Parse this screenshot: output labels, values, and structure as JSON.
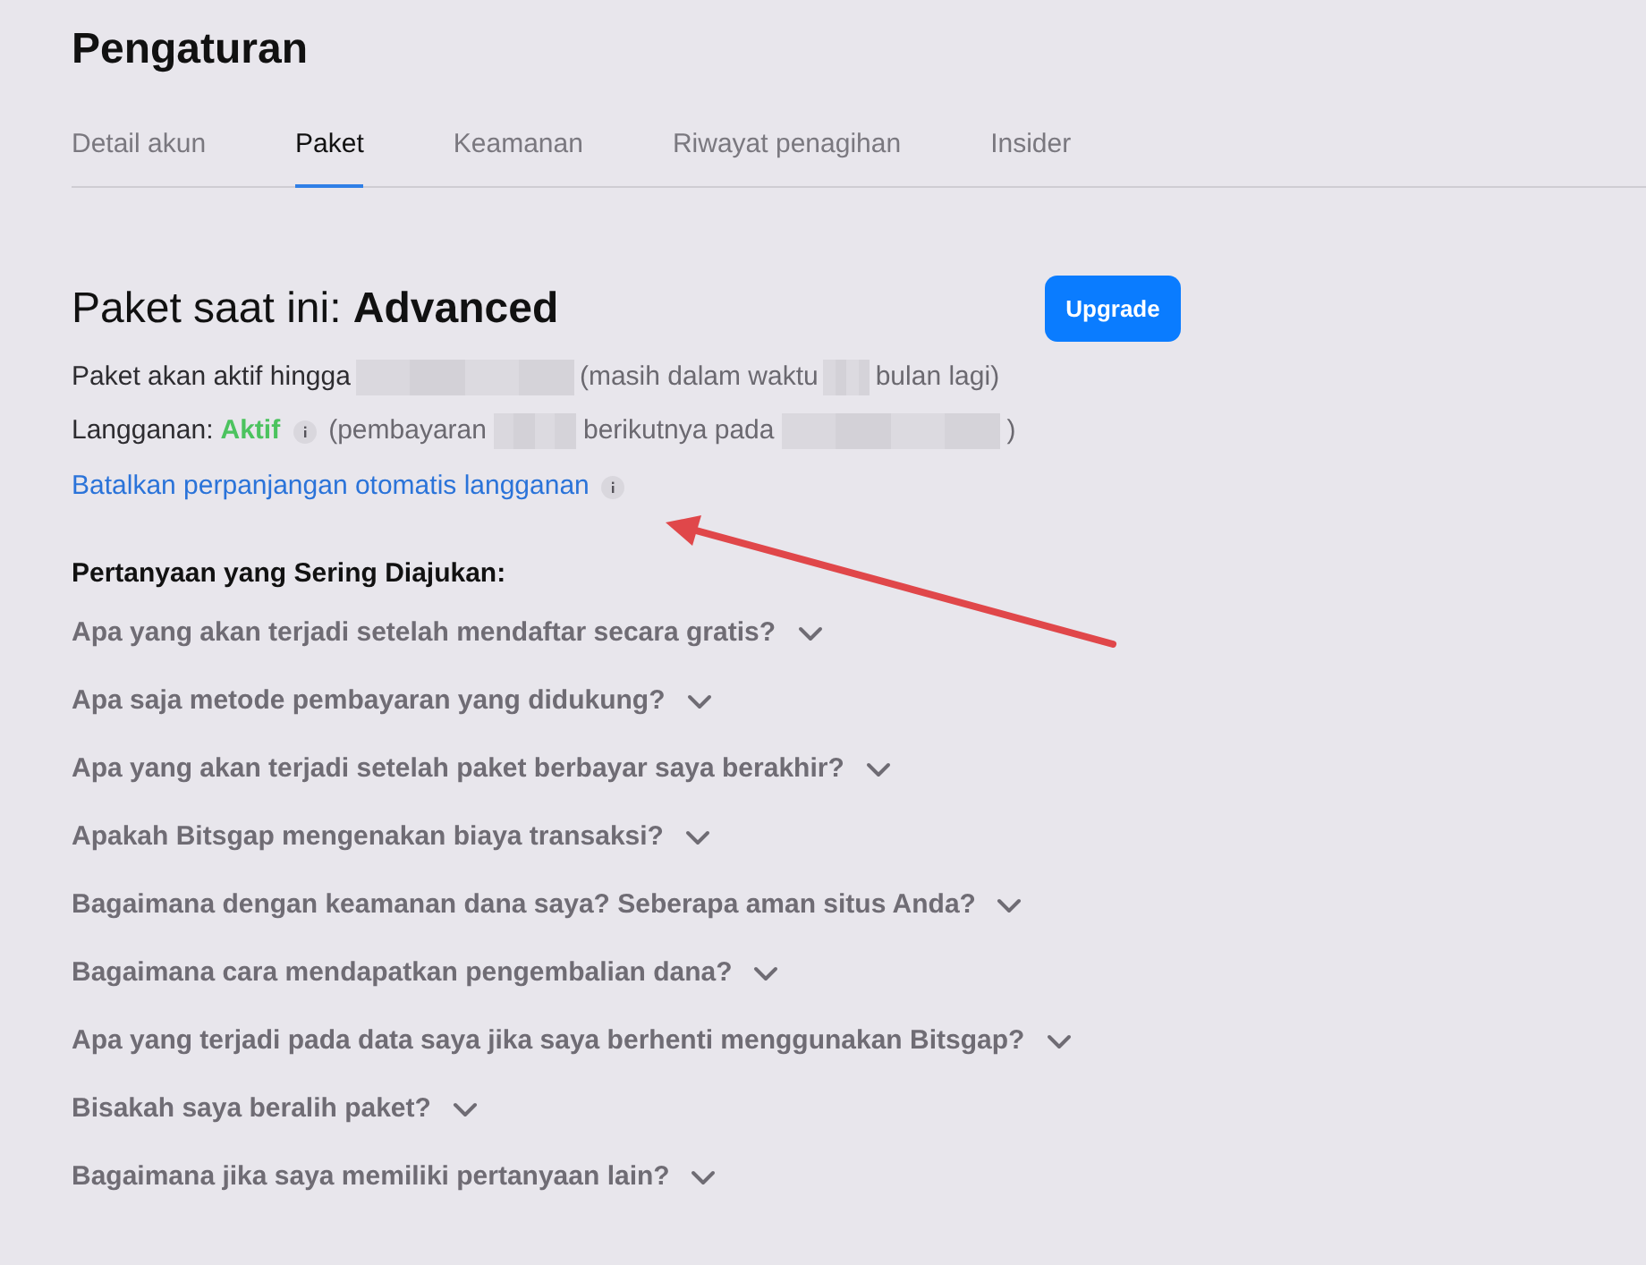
{
  "page": {
    "title": "Pengaturan"
  },
  "tabs": [
    {
      "label": "Detail akun",
      "selected": false
    },
    {
      "label": "Paket",
      "selected": true
    },
    {
      "label": "Keamanan",
      "selected": false
    },
    {
      "label": "Riwayat penagihan",
      "selected": false
    },
    {
      "label": "Insider",
      "selected": false
    }
  ],
  "plan": {
    "heading": "Paket saat ini: **Advanced**",
    "upgrade_button": "Upgrade",
    "active_until": [
      {
        "kind": "text",
        "text": "Paket akan aktif hingga"
      },
      {
        "kind": "redacted"
      },
      {
        "kind": "note",
        "text": "(masih dalam waktu"
      },
      {
        "kind": "redacted"
      },
      {
        "kind": "note",
        "text": "bulan lagi)"
      }
    ],
    "subscription": {
      "label": "Langganan:",
      "status": "Aktif",
      "segments": [
        {
          "kind": "note",
          "text": "(pembayaran"
        },
        {
          "kind": "redacted"
        },
        {
          "kind": "note",
          "text": "berikutnya pada"
        },
        {
          "kind": "redacted"
        },
        {
          "kind": "note",
          "text": ")"
        }
      ]
    },
    "cancel_link": "Batalkan perpanjangan otomatis langganan"
  },
  "faq": {
    "heading": "Pertanyaan yang Sering Diajukan:",
    "items": [
      {
        "question": "Apa yang akan terjadi setelah mendaftar secara gratis?",
        "expanded": false
      },
      {
        "question": "Apa saja metode pembayaran yang didukung?",
        "expanded": false
      },
      {
        "question": "Apa yang akan terjadi setelah paket berbayar saya berakhir?",
        "expanded": false
      },
      {
        "question": "Apakah Bitsgap mengenakan biaya transaksi?",
        "expanded": false
      },
      {
        "question": "Bagaimana dengan keamanan dana saya? Seberapa aman situs Anda?",
        "expanded": false
      },
      {
        "question": "Bagaimana cara mendapatkan pengembalian dana?",
        "expanded": false
      },
      {
        "question": "Apa yang terjadi pada data saya jika saya berhenti menggunakan Bitsgap?",
        "expanded": false
      },
      {
        "question": "Bisakah saya beralih paket?",
        "expanded": false
      },
      {
        "question": "Bagaimana jika saya memiliki pertanyaan lain?",
        "expanded": false
      }
    ]
  }
}
